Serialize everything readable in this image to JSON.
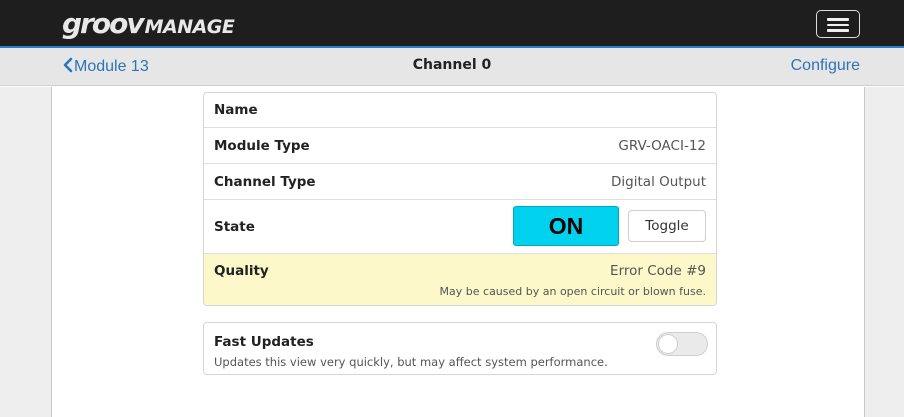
{
  "header": {
    "logo_part1": "groov",
    "logo_part2": "MANAGE",
    "menu_icon": "hamburger-menu-icon"
  },
  "nav": {
    "back_label": "Module 13",
    "back_icon": "chevron-left-icon",
    "title": "Channel 0",
    "configure_label": "Configure"
  },
  "channel": {
    "name_label": "Name",
    "name_value": "",
    "module_type_label": "Module Type",
    "module_type_value": "GRV-OACI-12",
    "channel_type_label": "Channel Type",
    "channel_type_value": "Digital Output",
    "state_label": "State",
    "state_value": "ON",
    "toggle_label": "Toggle",
    "quality_label": "Quality",
    "quality_value": "Error Code #9",
    "quality_note": "May be caused by an open circuit or blown fuse."
  },
  "fast_updates": {
    "label": "Fast Updates",
    "description": "Updates this view very quickly, but may affect system performance.",
    "enabled": false
  },
  "colors": {
    "header_bg": "#1e1e1e",
    "accent_blue": "#2d74b8",
    "state_on_bg": "#00d2ee",
    "quality_bg": "#fcf8c9"
  }
}
